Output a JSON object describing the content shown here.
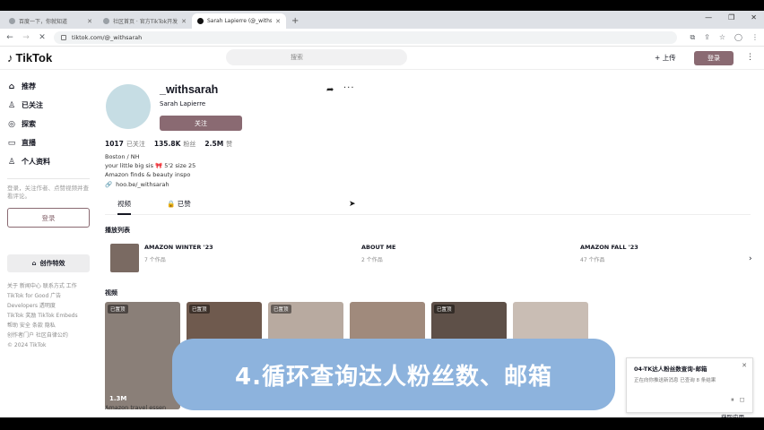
{
  "browser": {
    "tabs": [
      {
        "label": "百度一下，你就知道",
        "active": false
      },
      {
        "label": "社区首页 · 官方TikTok开发者社区",
        "active": false
      },
      {
        "label": "Sarah Lapierre (@_withsarah",
        "active": true
      }
    ],
    "new_tab": "+",
    "window_controls": [
      "—",
      "❐",
      "✕"
    ],
    "url": "tiktok.com/@_withsarah"
  },
  "header": {
    "logo": "TikTok",
    "search_placeholder": "搜索",
    "upload": "+ 上传",
    "login": "登录",
    "more": "⋮"
  },
  "sidebar": {
    "items": [
      {
        "icon": "home-icon",
        "glyph": "⌂",
        "label": "推荐"
      },
      {
        "icon": "following-icon",
        "glyph": "♙",
        "label": "已关注"
      },
      {
        "icon": "explore-icon",
        "glyph": "◎",
        "label": "探索"
      },
      {
        "icon": "live-icon",
        "glyph": "▭",
        "label": "直播"
      },
      {
        "icon": "profile-icon",
        "glyph": "♙",
        "label": "个人资料"
      }
    ],
    "note": "登录，关注作者、点赞视频并查看评论。",
    "login_button": "登录",
    "create_effects": "创作特效",
    "footer": [
      "关于  新闻中心  联系方式  工作",
      "TikTok for Good  广告",
      "Developers  透明度",
      "TikTok 奖励  TikTok Embeds",
      "帮助  安全  条款  隐私",
      "创作者门户  社区自律公约",
      "© 2024 TikTok"
    ]
  },
  "profile": {
    "username": "_withsarah",
    "nickname": "Sarah Lapierre",
    "follow_button": "关注",
    "share": "➦",
    "more": "···",
    "stats": [
      {
        "value": "1017",
        "label": "已关注"
      },
      {
        "value": "135.8K",
        "label": "粉丝"
      },
      {
        "value": "2.5M",
        "label": "赞"
      }
    ],
    "bio": [
      "Boston / NH",
      "your little big sis 🎀 5'2 size 25",
      "Amazon finds & beauty inspo"
    ],
    "link": "hoo.be/_withsarah",
    "tabs": [
      {
        "label": "视频",
        "active": true
      },
      {
        "label": "🔒 已赞",
        "active": false
      }
    ]
  },
  "playlists": {
    "title": "播放列表",
    "items": [
      {
        "name": "AMAZON WINTER '23",
        "count": "7 个作品"
      },
      {
        "name": "ABOUT ME",
        "count": "2 个作品"
      },
      {
        "name": "AMAZON FALL '23",
        "count": "47 个作品"
      }
    ],
    "next": "›"
  },
  "videos": {
    "title": "视频",
    "items": [
      {
        "badge": "已置顶",
        "views": "1.3M",
        "color": "#8a7f78"
      },
      {
        "badge": "已置顶",
        "views": "",
        "color": "#6f5a4e"
      },
      {
        "badge": "已置顶",
        "views": "",
        "color": "#b8aaa0"
      },
      {
        "badge": "",
        "views": "",
        "color": "#a08a7c"
      },
      {
        "badge": "已置顶",
        "views": "",
        "color": "#5e5048"
      },
      {
        "badge": "",
        "views": "",
        "color": "#c9bdb4"
      }
    ],
    "caption": "Amazon travel essen"
  },
  "overlay": {
    "banner_text": "4.循环查询达人粉丝数、邮箱",
    "banner_color": "#8db3dd"
  },
  "popup": {
    "title": "04-TK达人粉丝数查询-邮箱",
    "message": "正在向你推送新消息 已查询 8 条结果",
    "icons": "⏸ ◻",
    "button": "获取应用"
  },
  "colors": {
    "accent": "#8a6a72"
  }
}
